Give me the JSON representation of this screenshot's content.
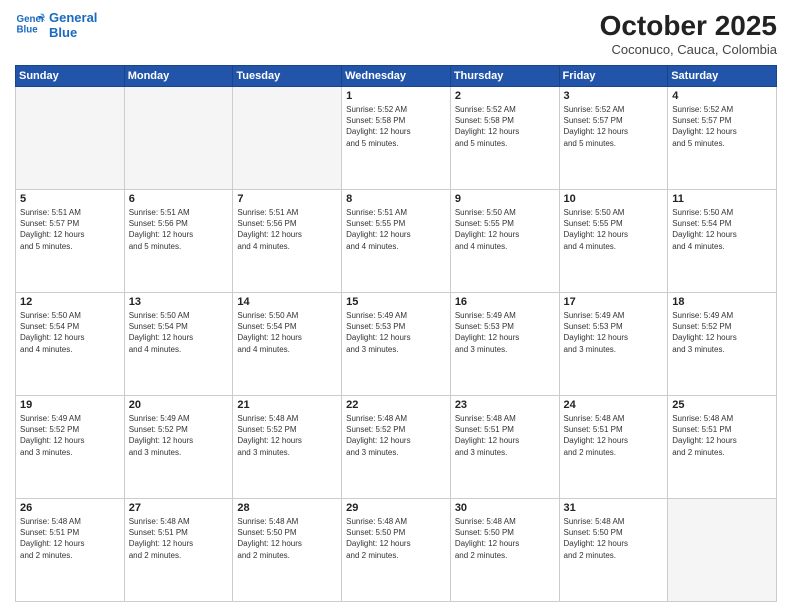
{
  "logo": {
    "line1": "General",
    "line2": "Blue"
  },
  "title": "October 2025",
  "subtitle": "Coconuco, Cauca, Colombia",
  "days_of_week": [
    "Sunday",
    "Monday",
    "Tuesday",
    "Wednesday",
    "Thursday",
    "Friday",
    "Saturday"
  ],
  "weeks": [
    [
      {
        "num": "",
        "info": ""
      },
      {
        "num": "",
        "info": ""
      },
      {
        "num": "",
        "info": ""
      },
      {
        "num": "1",
        "info": "Sunrise: 5:52 AM\nSunset: 5:58 PM\nDaylight: 12 hours\nand 5 minutes."
      },
      {
        "num": "2",
        "info": "Sunrise: 5:52 AM\nSunset: 5:58 PM\nDaylight: 12 hours\nand 5 minutes."
      },
      {
        "num": "3",
        "info": "Sunrise: 5:52 AM\nSunset: 5:57 PM\nDaylight: 12 hours\nand 5 minutes."
      },
      {
        "num": "4",
        "info": "Sunrise: 5:52 AM\nSunset: 5:57 PM\nDaylight: 12 hours\nand 5 minutes."
      }
    ],
    [
      {
        "num": "5",
        "info": "Sunrise: 5:51 AM\nSunset: 5:57 PM\nDaylight: 12 hours\nand 5 minutes."
      },
      {
        "num": "6",
        "info": "Sunrise: 5:51 AM\nSunset: 5:56 PM\nDaylight: 12 hours\nand 5 minutes."
      },
      {
        "num": "7",
        "info": "Sunrise: 5:51 AM\nSunset: 5:56 PM\nDaylight: 12 hours\nand 4 minutes."
      },
      {
        "num": "8",
        "info": "Sunrise: 5:51 AM\nSunset: 5:55 PM\nDaylight: 12 hours\nand 4 minutes."
      },
      {
        "num": "9",
        "info": "Sunrise: 5:50 AM\nSunset: 5:55 PM\nDaylight: 12 hours\nand 4 minutes."
      },
      {
        "num": "10",
        "info": "Sunrise: 5:50 AM\nSunset: 5:55 PM\nDaylight: 12 hours\nand 4 minutes."
      },
      {
        "num": "11",
        "info": "Sunrise: 5:50 AM\nSunset: 5:54 PM\nDaylight: 12 hours\nand 4 minutes."
      }
    ],
    [
      {
        "num": "12",
        "info": "Sunrise: 5:50 AM\nSunset: 5:54 PM\nDaylight: 12 hours\nand 4 minutes."
      },
      {
        "num": "13",
        "info": "Sunrise: 5:50 AM\nSunset: 5:54 PM\nDaylight: 12 hours\nand 4 minutes."
      },
      {
        "num": "14",
        "info": "Sunrise: 5:50 AM\nSunset: 5:54 PM\nDaylight: 12 hours\nand 4 minutes."
      },
      {
        "num": "15",
        "info": "Sunrise: 5:49 AM\nSunset: 5:53 PM\nDaylight: 12 hours\nand 3 minutes."
      },
      {
        "num": "16",
        "info": "Sunrise: 5:49 AM\nSunset: 5:53 PM\nDaylight: 12 hours\nand 3 minutes."
      },
      {
        "num": "17",
        "info": "Sunrise: 5:49 AM\nSunset: 5:53 PM\nDaylight: 12 hours\nand 3 minutes."
      },
      {
        "num": "18",
        "info": "Sunrise: 5:49 AM\nSunset: 5:52 PM\nDaylight: 12 hours\nand 3 minutes."
      }
    ],
    [
      {
        "num": "19",
        "info": "Sunrise: 5:49 AM\nSunset: 5:52 PM\nDaylight: 12 hours\nand 3 minutes."
      },
      {
        "num": "20",
        "info": "Sunrise: 5:49 AM\nSunset: 5:52 PM\nDaylight: 12 hours\nand 3 minutes."
      },
      {
        "num": "21",
        "info": "Sunrise: 5:48 AM\nSunset: 5:52 PM\nDaylight: 12 hours\nand 3 minutes."
      },
      {
        "num": "22",
        "info": "Sunrise: 5:48 AM\nSunset: 5:52 PM\nDaylight: 12 hours\nand 3 minutes."
      },
      {
        "num": "23",
        "info": "Sunrise: 5:48 AM\nSunset: 5:51 PM\nDaylight: 12 hours\nand 3 minutes."
      },
      {
        "num": "24",
        "info": "Sunrise: 5:48 AM\nSunset: 5:51 PM\nDaylight: 12 hours\nand 2 minutes."
      },
      {
        "num": "25",
        "info": "Sunrise: 5:48 AM\nSunset: 5:51 PM\nDaylight: 12 hours\nand 2 minutes."
      }
    ],
    [
      {
        "num": "26",
        "info": "Sunrise: 5:48 AM\nSunset: 5:51 PM\nDaylight: 12 hours\nand 2 minutes."
      },
      {
        "num": "27",
        "info": "Sunrise: 5:48 AM\nSunset: 5:51 PM\nDaylight: 12 hours\nand 2 minutes."
      },
      {
        "num": "28",
        "info": "Sunrise: 5:48 AM\nSunset: 5:50 PM\nDaylight: 12 hours\nand 2 minutes."
      },
      {
        "num": "29",
        "info": "Sunrise: 5:48 AM\nSunset: 5:50 PM\nDaylight: 12 hours\nand 2 minutes."
      },
      {
        "num": "30",
        "info": "Sunrise: 5:48 AM\nSunset: 5:50 PM\nDaylight: 12 hours\nand 2 minutes."
      },
      {
        "num": "31",
        "info": "Sunrise: 5:48 AM\nSunset: 5:50 PM\nDaylight: 12 hours\nand 2 minutes."
      },
      {
        "num": "",
        "info": ""
      }
    ]
  ]
}
